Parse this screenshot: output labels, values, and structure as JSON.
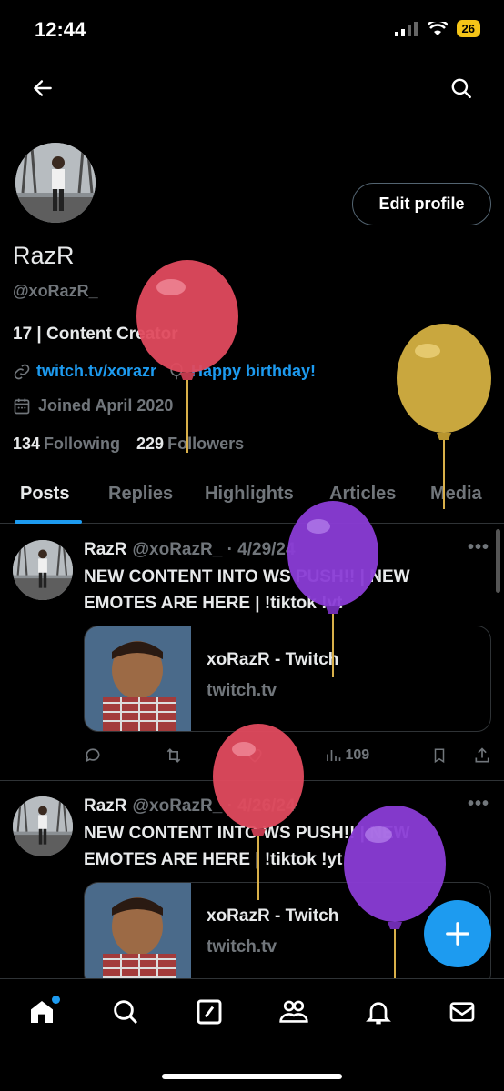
{
  "status_bar": {
    "time": "12:44",
    "battery": "26"
  },
  "profile": {
    "display_name": "RazR",
    "handle": "@xoRazR_",
    "bio": "17 | Content Creator",
    "link": "twitch.tv/xorazr",
    "birthday": "Happy birthday!",
    "joined": "Joined April 2020",
    "following_count": "134",
    "following_label": "Following",
    "followers_count": "229",
    "followers_label": "Followers",
    "edit_label": "Edit profile"
  },
  "tabs": [
    "Posts",
    "Replies",
    "Highlights",
    "Articles",
    "Media"
  ],
  "posts": [
    {
      "name": "RazR",
      "handle_date": "@xoRazR_ · 4/29/24",
      "text": "NEW CONTENT INTO WS PUSH!! | NEW EMOTES ARE HERE | !tiktok !yt",
      "card_title": "xoRazR - Twitch",
      "card_domain": "twitch.tv",
      "views": "109"
    },
    {
      "name": "RazR",
      "handle_date": "@xoRazR_ · 4/26/24",
      "text": "NEW CONTENT INTO WS PUSH!! | NEW EMOTES ARE HERE | !tiktok !yt",
      "card_title": "xoRazR - Twitch",
      "card_domain": "twitch.tv"
    }
  ],
  "colors": {
    "accent": "#1d9bf0",
    "background": "#000000",
    "muted": "#71767b"
  },
  "icons": [
    "back-arrow-icon",
    "search-icon",
    "home-icon",
    "explore-icon",
    "grok-icon",
    "communities-icon",
    "notifications-icon",
    "messages-icon",
    "compose-icon"
  ]
}
